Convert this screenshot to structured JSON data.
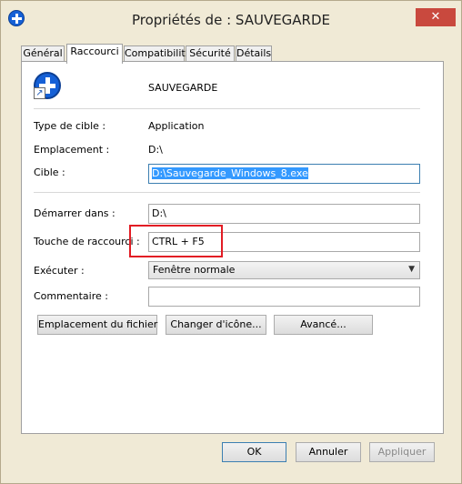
{
  "window": {
    "title": "Propriétés de : SAUVEGARDE",
    "close_symbol": "✕"
  },
  "tabs": [
    "Général",
    "Raccourci",
    "Compatibilité",
    "Sécurité",
    "Détails"
  ],
  "active_tab": "Raccourci",
  "shortcut": {
    "name": "SAUVEGARDE",
    "arrow_symbol": "↗"
  },
  "fields": {
    "target_type_label": "Type de cible :",
    "target_type_value": "Application",
    "location_label": "Emplacement :",
    "location_value": "D:\\",
    "target_label": "Cible :",
    "target_value": "D:\\Sauvegarde_Windows_8.exe",
    "start_in_label": "Démarrer dans :",
    "start_in_value": "D:\\",
    "hotkey_label": "Touche de raccourci :",
    "hotkey_value": "CTRL + F5",
    "run_label": "Exécuter :",
    "run_value": "Fenêtre normale",
    "comment_label": "Commentaire :",
    "comment_value": ""
  },
  "buttons": {
    "open_location": "Emplacement du fichier",
    "change_icon": "Changer d'icône...",
    "advanced": "Avancé...",
    "ok": "OK",
    "cancel": "Annuler",
    "apply": "Appliquer"
  },
  "colors": {
    "highlight_box": "#e21c24",
    "selection": "#3399ff",
    "close_button": "#c9493e"
  }
}
